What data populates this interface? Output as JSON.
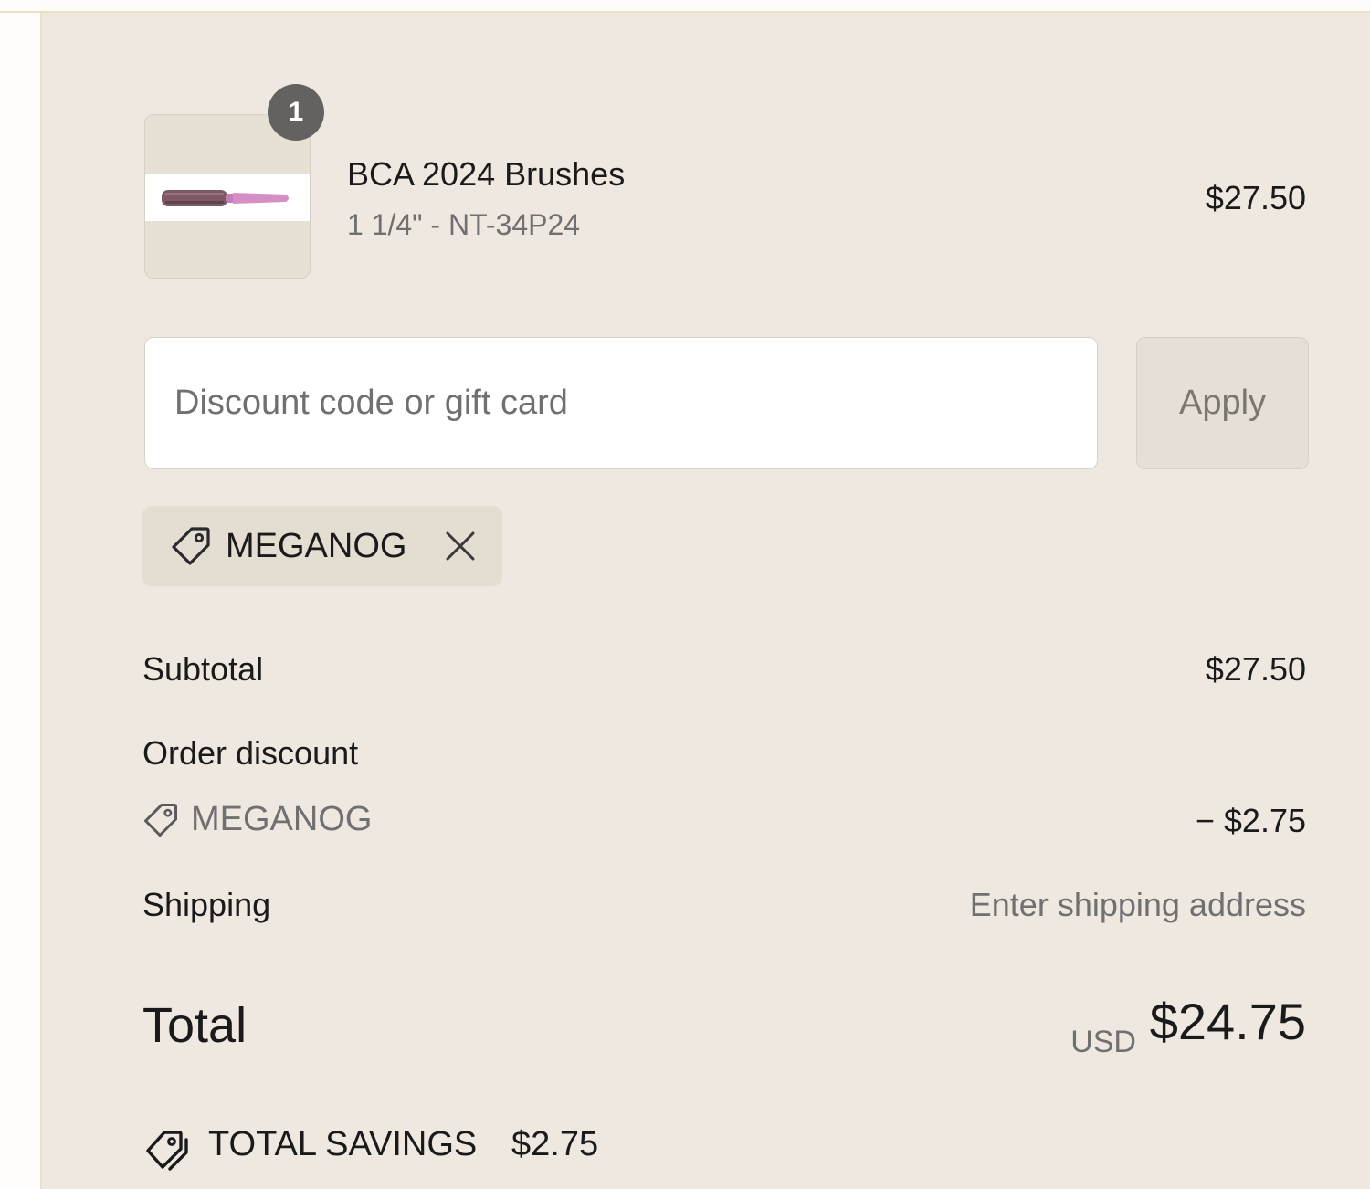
{
  "product": {
    "name": "BCA 2024 Brushes",
    "variant": "1 1/4\" - NT-34P24",
    "price": "$27.50",
    "quantity": "1",
    "thumbnail_icon": "round-hair-brush-pink"
  },
  "discount": {
    "placeholder": "Discount code or gift card",
    "value": "",
    "apply_label": "Apply",
    "applied_code": "MEGANOG",
    "tag_icon": "tag-icon",
    "remove_icon": "close-icon"
  },
  "summary": {
    "subtotal_label": "Subtotal",
    "subtotal_value": "$27.50",
    "order_discount_label": "Order discount",
    "order_discount_code": "MEGANOG",
    "order_discount_value": "− $2.75",
    "shipping_label": "Shipping",
    "shipping_value": "Enter shipping address",
    "total_label": "Total",
    "total_currency": "USD",
    "total_value": "$24.75",
    "savings_label": "TOTAL SAVINGS",
    "savings_value": "$2.75",
    "savings_icon": "double-tag-icon"
  },
  "colors": {
    "panel_background": "#eee8e1",
    "panel_border": "#efe0c3",
    "badge": "#646260",
    "muted_text": "#707070",
    "brush_pink": "#d58fc5"
  }
}
